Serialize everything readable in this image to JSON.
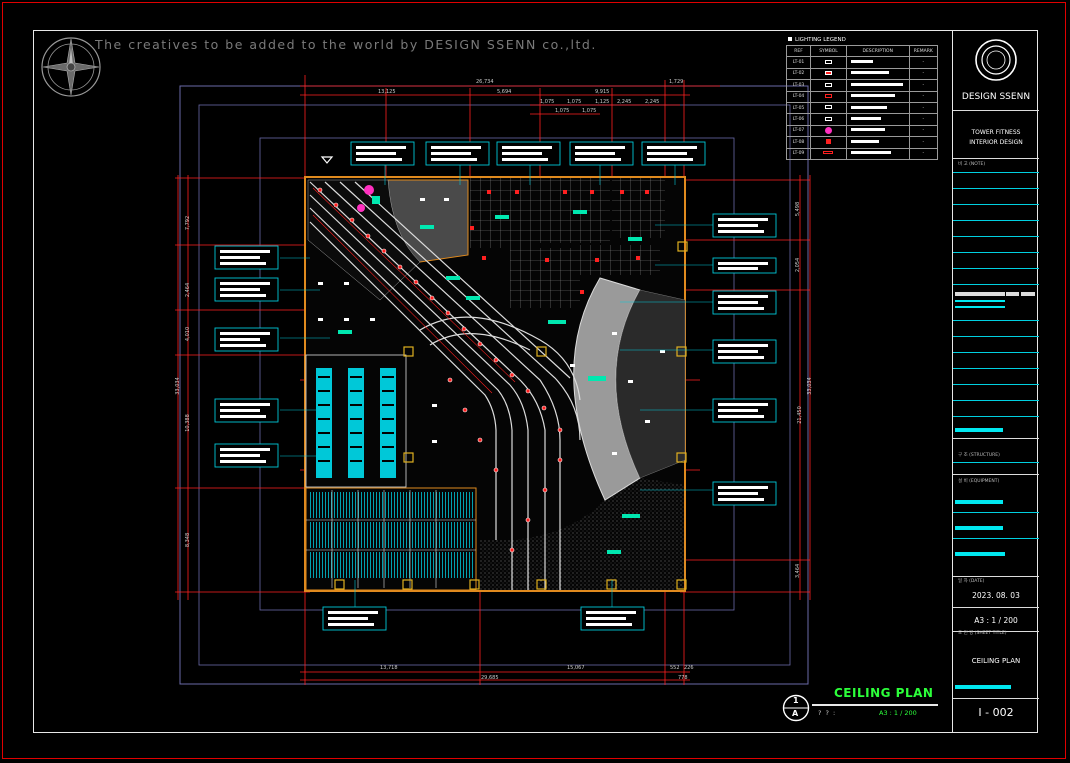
{
  "watermark": "The creatives to be added to the world by  DESIGN SSENN co.,ltd.",
  "legend": {
    "title": "LIGHTING LEGEND",
    "headers": [
      "REF",
      "SYMBOL",
      "DESCRIPTION",
      "REMARK"
    ],
    "rows": [
      {
        "ref": "LT-01",
        "remark": "-"
      },
      {
        "ref": "LT-02",
        "remark": "-"
      },
      {
        "ref": "LT-03",
        "remark": "-"
      },
      {
        "ref": "LT-04",
        "remark": "-"
      },
      {
        "ref": "LT-05",
        "remark": "-"
      },
      {
        "ref": "LT-06",
        "remark": "-"
      },
      {
        "ref": "LT-07",
        "remark": "-"
      },
      {
        "ref": "LT-08",
        "remark": "-"
      },
      {
        "ref": "LT-09",
        "remark": "-"
      }
    ]
  },
  "title_block": {
    "company": "DESIGN SSENN",
    "project_line1": "TOWER FITNESS",
    "project_line2": "INTERIOR DESIGN",
    "note_label": "비 고 (NOTE)",
    "structure_label": "구 조 (STRUCTURE)",
    "equipment_label": "설 비 (EQUIPMENT)",
    "date_label": "일 자 (DATE)",
    "date": "2023. 08. 03",
    "scale": "A3 : 1 / 200",
    "sheet_title_label": "도 면 명 (SHEET TITLE)",
    "sheet_title": "CEILING   PLAN",
    "sheet_no": "I  -  002"
  },
  "drawing_title": {
    "title": "CEILING PLAN",
    "number_top": "1",
    "number_bottom": "A",
    "scale": "A3 : 1 / 200",
    "placeholder": "? ? :"
  },
  "dimensions": {
    "top_row1": [
      "26,734",
      "1,729"
    ],
    "top_row2": [
      "13,125",
      "5,694",
      "9,915"
    ],
    "top_row3": [
      "1,075",
      "1,075",
      "1,125",
      "2,245",
      "2,245"
    ],
    "top_row4": [
      "1,075",
      "1,075"
    ],
    "left": [
      "7,792",
      "2,464",
      "4,010",
      "10,388",
      "8,348"
    ],
    "left_total": "33,034",
    "right": [
      "5,498",
      "2,054",
      "21,450",
      "3,464"
    ],
    "right_total": "33,034",
    "bottom_row1": [
      "13,718",
      "15,067",
      "552",
      "226"
    ],
    "bottom_row2": [
      "29,685",
      "778"
    ]
  },
  "colors": {
    "frame_red": "#e00000",
    "accent_green": "#2cff3a",
    "accent_cyan": "#00e8f0",
    "wall_orange": "#e08a1e",
    "dim_red": "#ff2020"
  }
}
